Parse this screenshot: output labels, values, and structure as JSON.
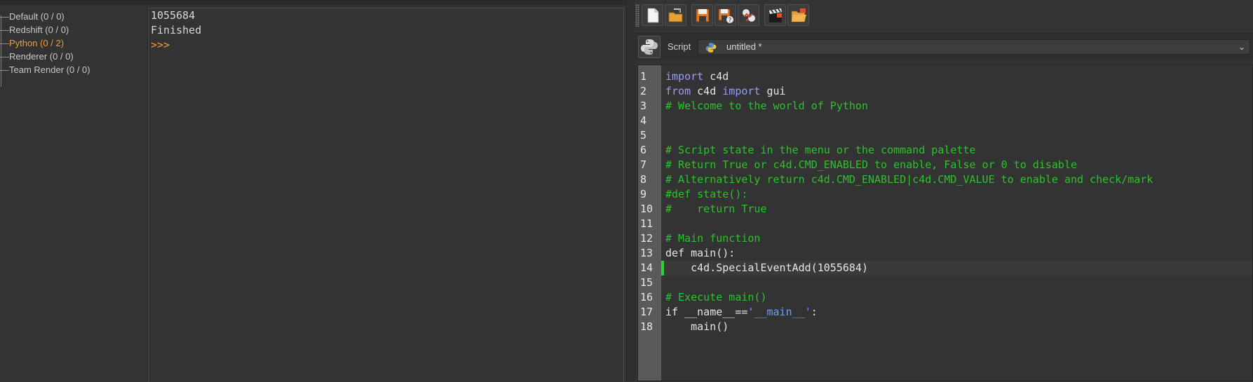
{
  "tree": {
    "items": [
      {
        "label": "Default (0 / 0)",
        "active": false
      },
      {
        "label": "Redshift (0 / 0)",
        "active": false
      },
      {
        "label": "Python (0 / 2)",
        "active": true
      },
      {
        "label": "Renderer (0 / 0)",
        "active": false
      },
      {
        "label": "Team Render  (0 / 0)",
        "active": false
      }
    ]
  },
  "console": {
    "lines": [
      "1055684",
      "Finished"
    ],
    "prompt": ">>>"
  },
  "toolbar": {
    "icons": [
      "new-script-icon",
      "open-script-icon",
      "save-icon",
      "save-as-icon",
      "python-objects-icon",
      "clapboard-icon",
      "folder-open-icon"
    ]
  },
  "script_bar": {
    "label": "Script",
    "selected": "untitled *"
  },
  "editor": {
    "current_line": 14,
    "lines": [
      [
        [
          "kw",
          "import"
        ],
        [
          "t",
          " c4d"
        ]
      ],
      [
        [
          "kw",
          "from"
        ],
        [
          "t",
          " c4d "
        ],
        [
          "kw",
          "import"
        ],
        [
          "t",
          " gui"
        ]
      ],
      [
        [
          "cm",
          "# Welcome to the world of Python"
        ]
      ],
      [],
      [],
      [
        [
          "cm",
          "# Script state in the menu or the command palette"
        ]
      ],
      [
        [
          "cm",
          "# Return True or c4d.CMD_ENABLED to enable, False or 0 to disable"
        ]
      ],
      [
        [
          "cm",
          "# Alternatively return c4d.CMD_ENABLED|c4d.CMD_VALUE to enable and check/mark"
        ]
      ],
      [
        [
          "cm",
          "#def state():"
        ]
      ],
      [
        [
          "cm",
          "#    return True"
        ]
      ],
      [],
      [
        [
          "cm",
          "# Main function"
        ]
      ],
      [
        [
          "t",
          "def main():"
        ]
      ],
      [
        [
          "t",
          "    c4d.SpecialEventAdd(1055684)"
        ]
      ],
      [],
      [
        [
          "cm",
          "# Execute main()"
        ]
      ],
      [
        [
          "t",
          "if __name__=="
        ],
        [
          "str",
          "'__main__'"
        ],
        [
          "t",
          ":"
        ]
      ],
      [
        [
          "t",
          "    main()"
        ]
      ]
    ]
  },
  "colors": {
    "accent": "#f29c38",
    "keyword": "#9b9bff",
    "comment": "#2bc22b",
    "string": "#6e9bff",
    "change_marker": "#29d43a"
  }
}
